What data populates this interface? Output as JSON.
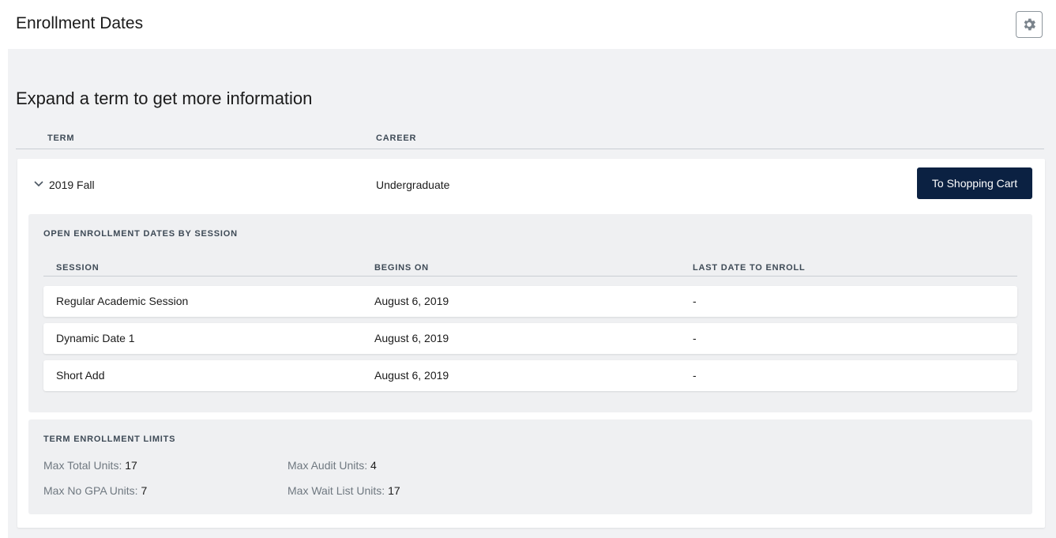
{
  "header": {
    "title": "Enrollment Dates",
    "settings_icon": "gear-icon"
  },
  "main": {
    "subtitle": "Expand a term to get more information",
    "columns": {
      "term": "TERM",
      "career": "CAREER"
    },
    "term": {
      "name": "2019 Fall",
      "career": "Undergraduate",
      "expanded": true,
      "toggle_icon": "chevron-down-icon",
      "cart_button": "To Shopping Cart"
    },
    "sessions": {
      "label": "OPEN ENROLLMENT DATES BY SESSION",
      "columns": {
        "session": "SESSION",
        "begins": "BEGINS ON",
        "last": "LAST DATE TO ENROLL"
      },
      "rows": [
        {
          "session": "Regular Academic Session",
          "begins": "August 6, 2019",
          "last": "-"
        },
        {
          "session": "Dynamic Date 1",
          "begins": "August 6, 2019",
          "last": "-"
        },
        {
          "session": "Short Add",
          "begins": "August 6, 2019",
          "last": "-"
        }
      ]
    },
    "limits": {
      "label": "TERM ENROLLMENT LIMITS",
      "max_total": {
        "label": "Max Total Units:",
        "value": "17"
      },
      "max_audit": {
        "label": "Max Audit Units:",
        "value": "4"
      },
      "max_no_gpa": {
        "label": "Max No GPA Units:",
        "value": "7"
      },
      "max_wait_list": {
        "label": "Max Wait List Units:",
        "value": "17"
      }
    }
  },
  "colors": {
    "primary_button": "#0b2142",
    "page_background": "#f1f2f4",
    "card_background": "#ffffff"
  }
}
